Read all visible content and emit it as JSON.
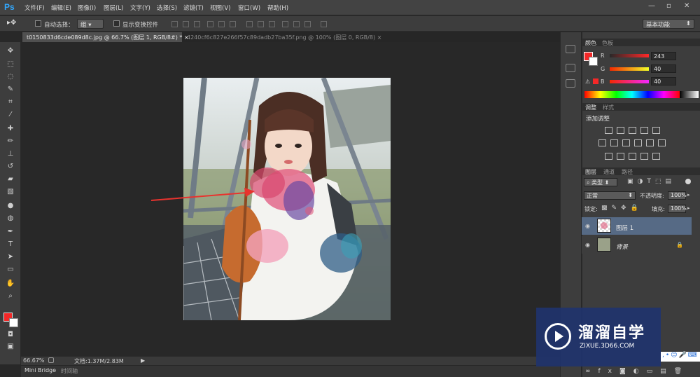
{
  "app": {
    "logo": "Ps"
  },
  "menu": [
    "文件(F)",
    "编辑(E)",
    "图像(I)",
    "图层(L)",
    "文字(Y)",
    "选择(S)",
    "滤镜(T)",
    "视图(V)",
    "窗口(W)",
    "帮助(H)"
  ],
  "window_controls": [
    "—",
    "▫",
    "✕"
  ],
  "options": {
    "auto_select_label": "自动选择：",
    "auto_select_value": "组",
    "show_transform_label": "显示变换控件",
    "workspace": "基本功能"
  },
  "tabs": [
    {
      "label": "t0150833d6cde089d8c.jpg @ 66.7% (图层 1, RGB/8#) *",
      "close": "×",
      "active": true
    },
    {
      "label": "4240cf6c827e266f57c89dadb27ba35f.png @ 100% (图层 0, RGB/8)",
      "close": "×",
      "active": false
    }
  ],
  "status": {
    "zoom": "66.67%",
    "doc": "文档:1.37M/2.83M"
  },
  "bottom_tabs": [
    "Mini Bridge",
    "时间轴"
  ],
  "color_panel": {
    "tabs": [
      "颜色",
      "色板"
    ],
    "channels": [
      {
        "name": "R",
        "value": "243"
      },
      {
        "name": "G",
        "value": "40"
      },
      {
        "name": "B",
        "value": "40"
      }
    ],
    "foreground": "#f32828",
    "background": "#ffffff"
  },
  "adjust_panel": {
    "tabs": [
      "调整",
      "样式"
    ],
    "title": "添加调整"
  },
  "layers_panel": {
    "tabs": [
      "图层",
      "通道",
      "路径"
    ],
    "filter_label": "类型",
    "blend_mode": "正常",
    "opacity_label": "不透明度:",
    "opacity": "100%",
    "lock_label": "锁定:",
    "fill_label": "填充:",
    "fill": "100%",
    "layers": [
      {
        "name": "图层 1",
        "selected": true,
        "locked": false
      },
      {
        "name": "背景",
        "selected": false,
        "locked": true
      }
    ]
  },
  "watermark": {
    "title": "溜溜自学",
    "url": "ZIXUE.3D66.COM"
  },
  "colors": {
    "accent_red": "#f32828",
    "ps_blue": "#31a8ff",
    "selected_layer": "#566a85"
  }
}
